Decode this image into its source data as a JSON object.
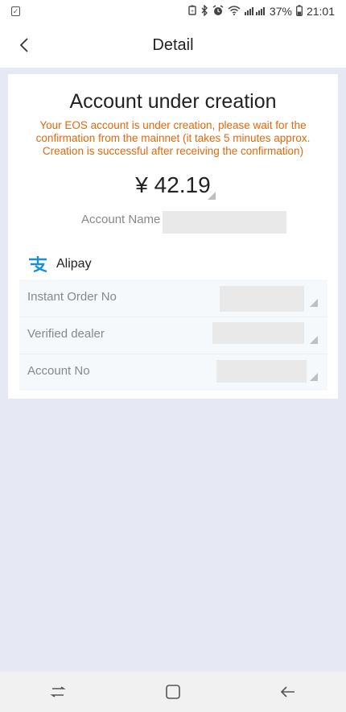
{
  "status_bar": {
    "battery": "37%",
    "time": "21:01",
    "icons": [
      "checklist-icon",
      "battery-saver-icon",
      "bluetooth-icon",
      "alarm-icon",
      "wifi-icon",
      "signal-icon"
    ]
  },
  "header": {
    "title": "Detail",
    "back_icon": "chevron-left-icon"
  },
  "order": {
    "status_title": "Account under creation",
    "notice": "Your EOS account is under creation, please wait for the confirmation from the mainnet (it takes 5 minutes approx. Creation is successful after receiving the confirmation)",
    "amount": "¥ 42.19",
    "account_name_label": "Account Name",
    "payment_method": "Alipay",
    "details": [
      {
        "label": "Instant Order No"
      },
      {
        "label": "Verified dealer"
      },
      {
        "label": "Account No"
      }
    ]
  },
  "colors": {
    "notice": "#e0680d",
    "alipay": "#1a8fd9",
    "background": "#e6e9f3"
  },
  "nav": {
    "icons": [
      "recent-apps-icon",
      "home-icon",
      "back-arrow-icon"
    ]
  }
}
